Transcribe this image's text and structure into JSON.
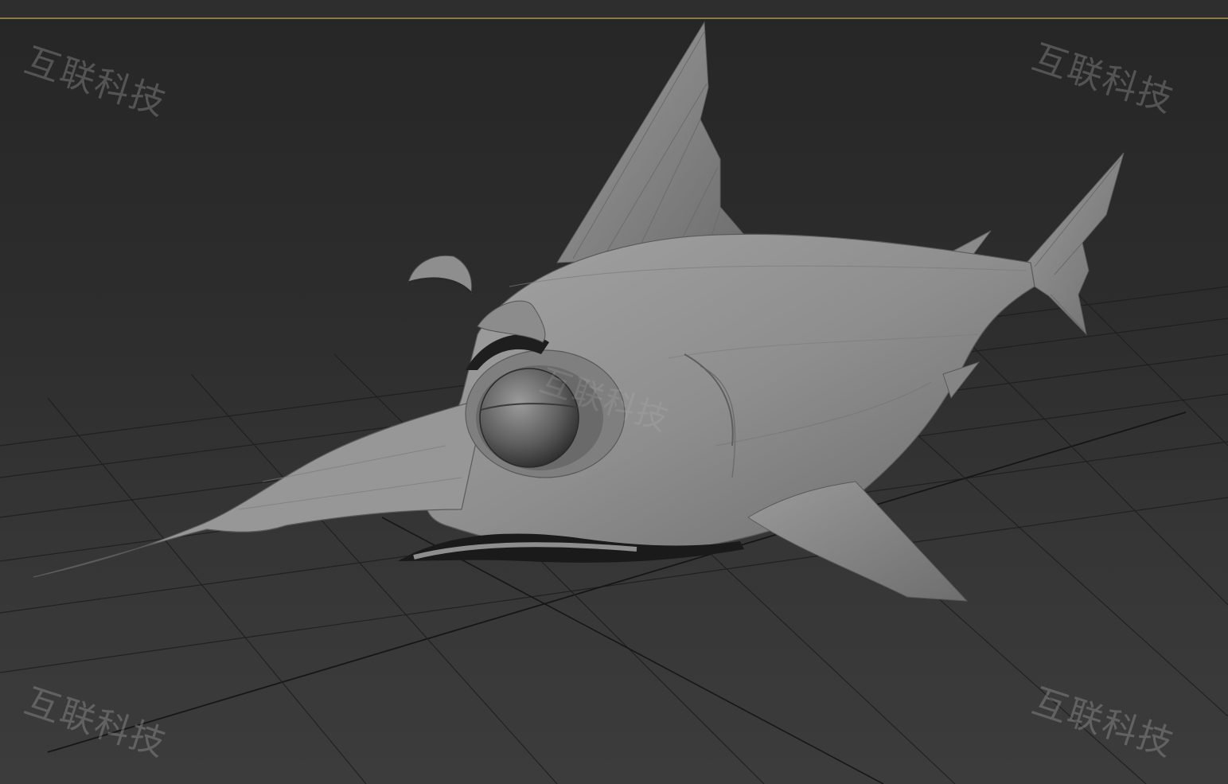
{
  "viewport": {
    "label": "3D viewport",
    "background_color": "#2d2d2d",
    "grid_color": "#1c1c1c",
    "mesh_color": "#8a8a8a",
    "accent_line_color": "#8c7a4a"
  },
  "model": {
    "subject": "swordfish",
    "shading": "clay"
  },
  "watermarks": {
    "top_left": "互联科技",
    "top_right": "互联科技",
    "bottom_left": "互联科技",
    "bottom_right": "互联科技",
    "center": "互联科技"
  }
}
